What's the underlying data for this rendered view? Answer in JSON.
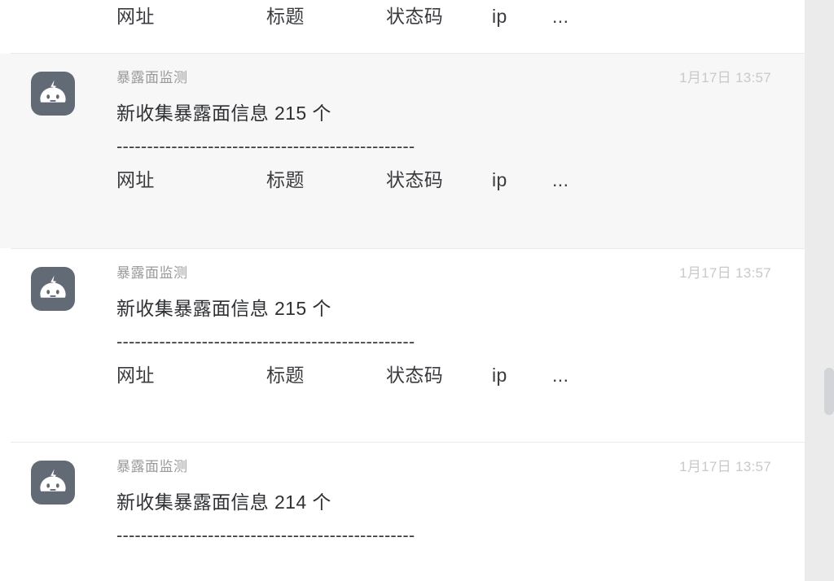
{
  "app": {
    "background_color": "#ffffff",
    "highlight_color": "#f7f7f7",
    "divider_color": "#ebebeb",
    "avatar_color": "#626b75",
    "title_color": "#9a9a9a",
    "text_color": "#2f3034",
    "time_color": "#c9c9c9"
  },
  "scrollbar": {
    "track_color": "#ebebeb",
    "thumb_color": "#d2d4d7",
    "name": "vertical-scrollbar"
  },
  "messages": [
    {
      "avatar_icon": "robot-icon",
      "title": "",
      "time": "",
      "text": "",
      "rule": "",
      "fields": [
        "网址",
        "标题",
        "状态码",
        "ip",
        "..."
      ],
      "highlighted": false,
      "partial": true
    },
    {
      "avatar_icon": "robot-icon",
      "title": "暴露面监测",
      "time": "1月17日 13:57",
      "text": "新收集暴露面信息 215 个",
      "rule": "-------------------------------------------------",
      "fields": [
        "网址",
        "标题",
        "状态码",
        "ip",
        "..."
      ],
      "highlighted": true,
      "partial": false
    },
    {
      "avatar_icon": "robot-icon",
      "title": "暴露面监测",
      "time": "1月17日 13:57",
      "text": "新收集暴露面信息 215 个",
      "rule": "-------------------------------------------------",
      "fields": [
        "网址",
        "标题",
        "状态码",
        "ip",
        "..."
      ],
      "highlighted": false,
      "partial": false
    },
    {
      "avatar_icon": "robot-icon",
      "title": "暴露面监测",
      "time": "1月17日 13:57",
      "text": "新收集暴露面信息 214 个",
      "rule": "-------------------------------------------------",
      "fields": [],
      "highlighted": false,
      "partial": false
    }
  ]
}
